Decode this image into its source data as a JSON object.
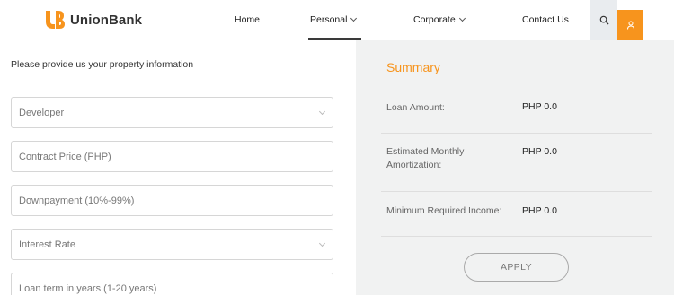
{
  "header": {
    "brand": "UnionBank",
    "nav": [
      {
        "label": "Home"
      },
      {
        "label": "Personal"
      },
      {
        "label": "Corporate"
      },
      {
        "label": "Contact Us"
      }
    ],
    "accent_color": "#f7941d",
    "active_nav": "Personal",
    "search_icon": "search-icon",
    "user_icon": "user-icon"
  },
  "form": {
    "heading": "Please provide us your property information",
    "fields": [
      {
        "placeholder": "Developer",
        "type": "select"
      },
      {
        "placeholder": "Contract Price (PHP)",
        "type": "input"
      },
      {
        "placeholder": "Downpayment (10%-99%)",
        "type": "input"
      },
      {
        "placeholder": "Interest Rate",
        "type": "select"
      },
      {
        "placeholder": "Loan term in years (1-20 years)",
        "type": "input"
      }
    ]
  },
  "summary": {
    "title": "Summary",
    "rows": [
      {
        "label": "Loan Amount:",
        "value": "PHP 0.0"
      },
      {
        "label": "Estimated Monthly Amortization:",
        "value": "PHP 0.0"
      },
      {
        "label": "Minimum Required Income:",
        "value": "PHP 0.0"
      }
    ],
    "apply_label": "APPLY"
  }
}
